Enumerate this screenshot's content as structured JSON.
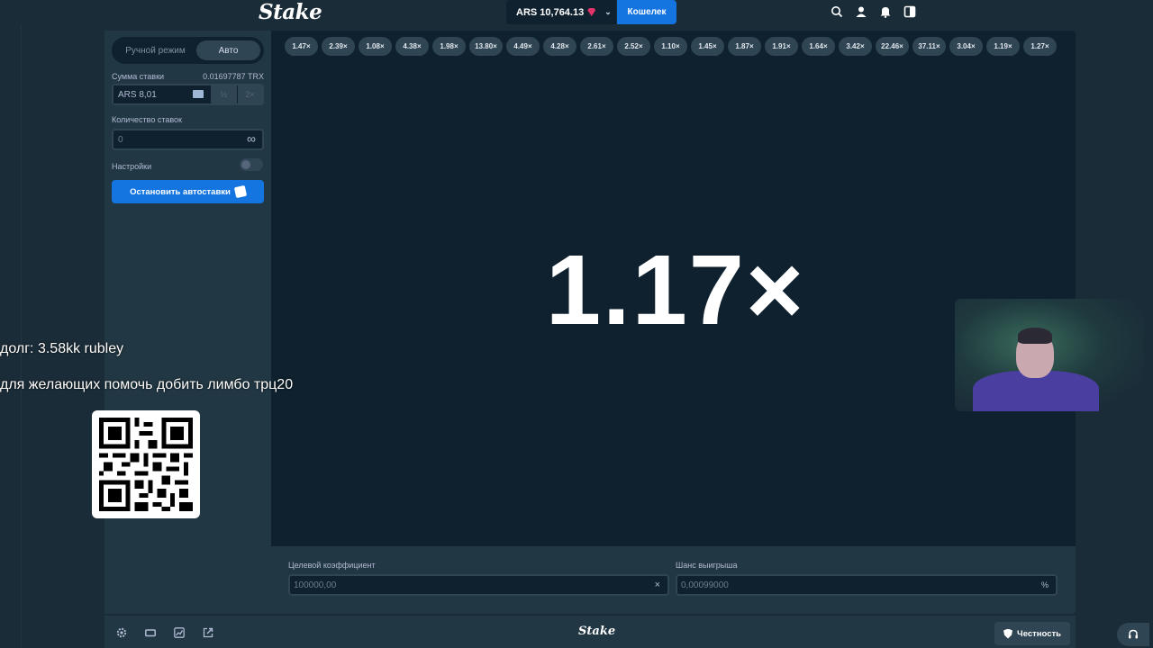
{
  "topbar": {
    "logo": "Stake",
    "balance": "ARS 10,764.13",
    "wallet_label": "Кошелек",
    "icons": [
      "search-icon",
      "user-icon",
      "bell-icon",
      "sidebar-toggle-icon"
    ]
  },
  "sidebar": {
    "mode_manual": "Ручной режим",
    "mode_auto": "Авто",
    "bet_amount_label": "Сумма ставки",
    "bet_amount_crypto": "0.01697787 TRX",
    "bet_amount_value": "ARS 8,01",
    "half_label": "½",
    "double_label": "2×",
    "bets_count_label": "Количество ставок",
    "bets_count_value": "0",
    "infinity_symbol": "∞",
    "settings_label": "Настройки",
    "settings_enabled": false,
    "stop_autobet_label": "Остановить автоставки"
  },
  "history": [
    "1.47×",
    "2.39×",
    "1.08×",
    "4.38×",
    "1.98×",
    "13.80×",
    "4.49×",
    "4.28×",
    "2.61×",
    "2.52×",
    "1.10×",
    "1.45×",
    "1.87×",
    "1.91×",
    "1.64×",
    "3.42×",
    "22.46×",
    "37.11×",
    "3.04×",
    "1.19×",
    "1.27×"
  ],
  "game": {
    "multiplier": "1.17×"
  },
  "inputs": {
    "target_label": "Целевой коэффициент",
    "target_value": "100000,00",
    "target_suffix": "×",
    "chance_label": "Шанс выигрыша",
    "chance_value": "0,00099000",
    "chance_suffix": "%"
  },
  "footer": {
    "logo": "Stake",
    "fairness_label": "Честность",
    "icons": [
      "settings-icon",
      "theater-mode-icon",
      "stats-icon",
      "popout-icon"
    ]
  },
  "overlay": {
    "debt_text": "долг: 3.58kk rubley",
    "help_text": "для желающих помочь добить лимбо трц20"
  },
  "colors": {
    "background": "#1a2c38",
    "panel": "#213743",
    "game_bg": "#0f212e",
    "accent_blue": "#1475e1",
    "pill": "#2f4553"
  }
}
